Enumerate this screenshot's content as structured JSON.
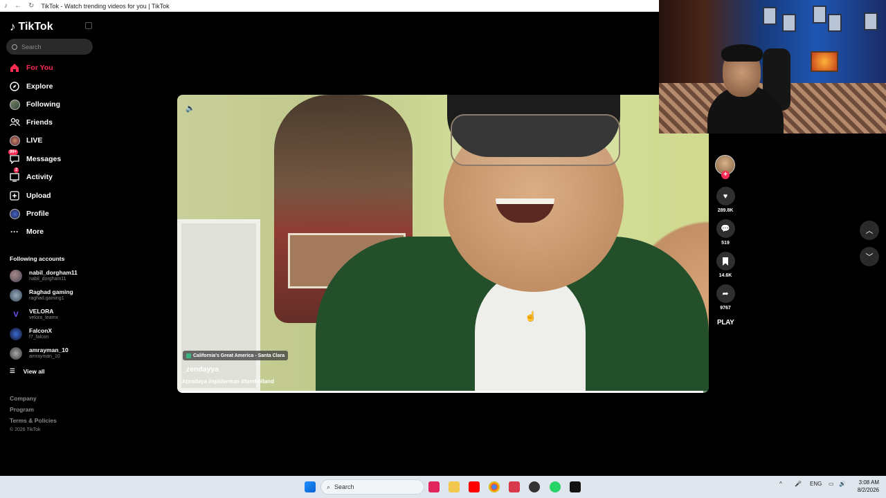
{
  "browser": {
    "tab_title": "TikTok - Watch trending videos for you | TikTok"
  },
  "sidebar": {
    "logo_text": "TikTok",
    "search_placeholder": "Search",
    "nav": [
      {
        "label": "For You",
        "icon": "home-icon",
        "active": true
      },
      {
        "label": "Explore",
        "icon": "compass-icon"
      },
      {
        "label": "Following",
        "icon": "following-avatar-icon"
      },
      {
        "label": "Friends",
        "icon": "friends-icon"
      },
      {
        "label": "LIVE",
        "icon": "live-icon"
      },
      {
        "label": "Messages",
        "icon": "messages-icon",
        "badge": "99+"
      },
      {
        "label": "Activity",
        "icon": "activity-icon",
        "badge": "2"
      },
      {
        "label": "Upload",
        "icon": "upload-icon"
      },
      {
        "label": "Profile",
        "icon": "profile-avatar-icon"
      },
      {
        "label": "More",
        "icon": "more-icon"
      }
    ],
    "following_title": "Following accounts",
    "accounts": [
      {
        "name": "nabil_dorgham11",
        "handle": "nabil_dorgham11"
      },
      {
        "name": "Raghad gaming",
        "handle": "raghad.gaming1"
      },
      {
        "name": "VELORA",
        "handle": "velora_teamx"
      },
      {
        "name": "FalconX",
        "handle": "f7_falcon"
      },
      {
        "name": "amrayman_10",
        "handle": "amrayman_10"
      }
    ],
    "view_all": "View all",
    "footer": [
      "Company",
      "Program",
      "Terms & Policies"
    ],
    "copyright": "© 2026 TikTok"
  },
  "video": {
    "location": "California's Great America - Santa Clara",
    "username": "_zendayya",
    "hashtags": "#zendaya #spiderman #tomholland",
    "progress": 0.99
  },
  "actions": {
    "likes": "289.8K",
    "comments": "519",
    "saves": "14.6K",
    "shares": "9767",
    "play_label": "PLAY"
  },
  "taskbar": {
    "search_label": "Search",
    "language": "ENG",
    "time": "3:08 AM",
    "date": "8/2/2026"
  },
  "colors": {
    "accent": "#fe2c55",
    "background": "#000000",
    "taskbar": "#dfe6ee"
  }
}
